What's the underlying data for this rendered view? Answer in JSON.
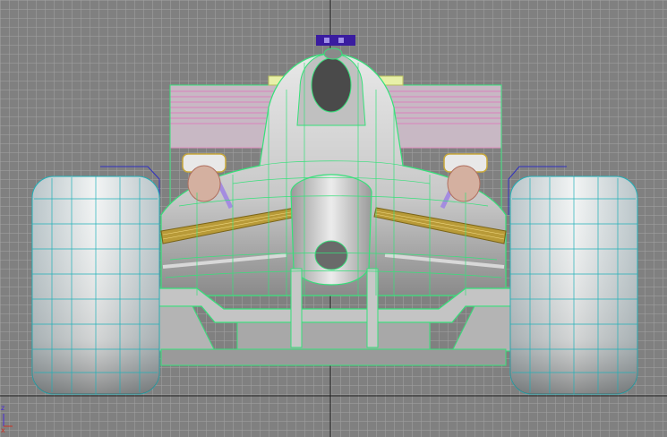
{
  "viewport": {
    "name": "front-viewport",
    "background": "#808080",
    "grid_color": "#a0a0a0",
    "origin_line_color": "#202020"
  },
  "axis_tripod": {
    "z_label": "z",
    "x_label": "x",
    "z_color": "#4a2cd8",
    "x_color": "#d03020"
  },
  "model": {
    "object": "formula-one-car",
    "view": "front",
    "wireframe_color": "#36e07a",
    "tire_wire_color": "#20b0b8",
    "rear_wing_color": "#e090c0",
    "suspension_color": "#c8a83a",
    "top_marker_color": "#3a1ca0"
  }
}
